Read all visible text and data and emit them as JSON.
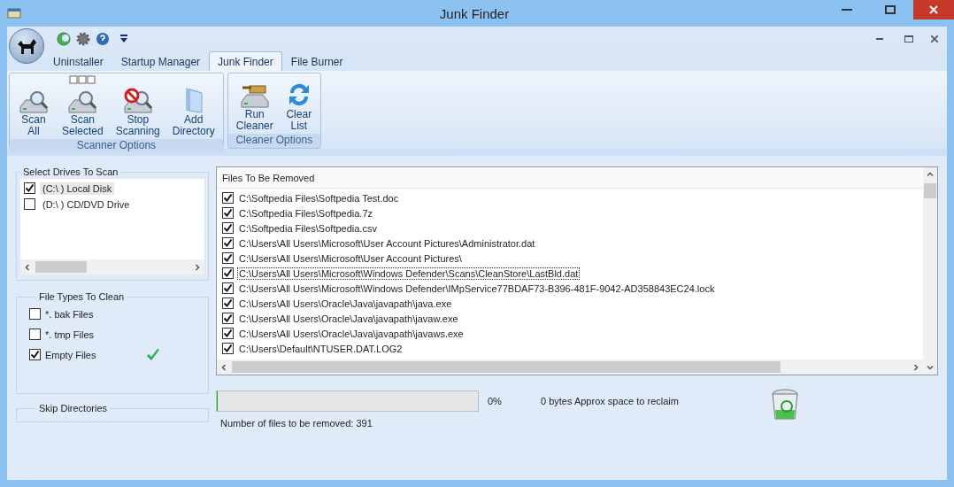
{
  "window": {
    "title": "Junk Finder"
  },
  "tabs": [
    {
      "label": "Uninstaller",
      "selected": false
    },
    {
      "label": "Startup Manager",
      "selected": false
    },
    {
      "label": "Junk Finder",
      "selected": true
    },
    {
      "label": "File Burner",
      "selected": false
    }
  ],
  "ribbon_groups": [
    {
      "label": "Scanner Options",
      "buttons": [
        {
          "kind": "scan_all",
          "lines": [
            "Scan",
            "All"
          ]
        },
        {
          "kind": "scan_selected",
          "lines": [
            "Scan",
            "Selected"
          ]
        },
        {
          "kind": "stop",
          "lines": [
            "Stop",
            "Scanning"
          ]
        },
        {
          "kind": "folder",
          "lines": [
            "Add",
            "Directory"
          ]
        }
      ]
    },
    {
      "label": "Cleaner Options",
      "buttons": [
        {
          "kind": "cleaner",
          "lines": [
            "Run",
            "Cleaner"
          ]
        },
        {
          "kind": "refresh",
          "lines": [
            "Clear",
            "List"
          ]
        }
      ]
    }
  ],
  "drives": {
    "title": "Select Drives To Scan",
    "items": [
      {
        "label": "(C:\\ ) Local Disk",
        "checked": true,
        "selected": true
      },
      {
        "label": "(D:\\ ) CD/DVD Drive",
        "checked": false,
        "selected": false
      }
    ]
  },
  "file_types": {
    "title": "File Types To Clean",
    "items": [
      {
        "label": "*. bak Files",
        "checked": false
      },
      {
        "label": "*. tmp Files",
        "checked": false
      },
      {
        "label": "Empty Files",
        "checked": true
      }
    ]
  },
  "skip_directories": {
    "title": "Skip Directories"
  },
  "files": {
    "title": "Files To Be Removed",
    "items": [
      {
        "path": "C:\\Softpedia Files\\Softpedia Test.doc",
        "checked": true,
        "selected": false
      },
      {
        "path": "C:\\Softpedia Files\\Softpedia.7z",
        "checked": true,
        "selected": false
      },
      {
        "path": "C:\\Softpedia Files\\Softpedia.csv",
        "checked": true,
        "selected": false
      },
      {
        "path": "C:\\Users\\All Users\\Microsoft\\User Account Pictures\\Administrator.dat",
        "checked": true,
        "selected": false
      },
      {
        "path": "C:\\Users\\All Users\\Microsoft\\User Account Pictures\\",
        "checked": true,
        "selected": false
      },
      {
        "path": "C:\\Users\\All Users\\Microsoft\\Windows Defender\\Scans\\CleanStore\\LastBld.dat",
        "checked": true,
        "selected": true
      },
      {
        "path": "C:\\Users\\All Users\\Microsoft\\Windows Defender\\IMpService77BDAF73-B396-481F-9042-AD358843EC24.lock",
        "checked": true,
        "selected": false
      },
      {
        "path": "C:\\Users\\All Users\\Oracle\\Java\\javapath\\java.exe",
        "checked": true,
        "selected": false
      },
      {
        "path": "C:\\Users\\All Users\\Oracle\\Java\\javapath\\javaw.exe",
        "checked": true,
        "selected": false
      },
      {
        "path": "C:\\Users\\All Users\\Oracle\\Java\\javapath\\javaws.exe",
        "checked": true,
        "selected": false
      },
      {
        "path": "C:\\Users\\Default\\NTUSER.DAT.LOG2",
        "checked": true,
        "selected": false
      }
    ]
  },
  "progress": {
    "level": 0,
    "percent": "0%",
    "space": "0 bytes Approx space to reclaim"
  },
  "file_count": "Number of files to be removed: 391"
}
